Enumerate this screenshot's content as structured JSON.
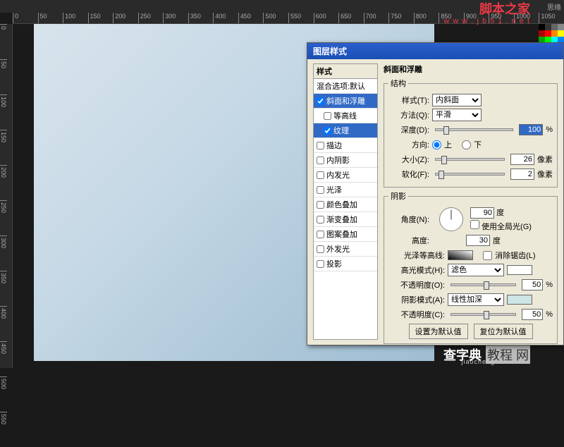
{
  "toolbar_text": "思缘",
  "watermark_top": {
    "main": "脚本之家",
    "sub": "w w w . j b 5 1 . n e t"
  },
  "watermark_bot": {
    "cn": "查字典",
    "box": "教程 网",
    "py": "jiaocheng"
  },
  "ruler_h": [
    "0",
    "50",
    "100",
    "150",
    "200",
    "250",
    "300",
    "350",
    "400",
    "450",
    "500",
    "550",
    "600",
    "650",
    "700",
    "750",
    "800",
    "850",
    "900",
    "950",
    "1000",
    "1050"
  ],
  "ruler_v": [
    "0",
    "50",
    "100",
    "150",
    "200",
    "250",
    "300",
    "350",
    "400",
    "450",
    "500",
    "550"
  ],
  "dialog": {
    "title": "图层样式",
    "styles_header": "样式",
    "blend_options": "混合选项:默认",
    "style_list": [
      {
        "label": "斜面和浮雕",
        "checked": true,
        "selected": true,
        "sub": false
      },
      {
        "label": "等高线",
        "checked": false,
        "selected": false,
        "sub": true
      },
      {
        "label": "纹理",
        "checked": true,
        "selected": true,
        "sub": true
      },
      {
        "label": "描边",
        "checked": false,
        "selected": false,
        "sub": false
      },
      {
        "label": "内阴影",
        "checked": false,
        "selected": false,
        "sub": false
      },
      {
        "label": "内发光",
        "checked": false,
        "selected": false,
        "sub": false
      },
      {
        "label": "光泽",
        "checked": false,
        "selected": false,
        "sub": false
      },
      {
        "label": "颜色叠加",
        "checked": false,
        "selected": false,
        "sub": false
      },
      {
        "label": "渐变叠加",
        "checked": false,
        "selected": false,
        "sub": false
      },
      {
        "label": "图案叠加",
        "checked": false,
        "selected": false,
        "sub": false
      },
      {
        "label": "外发光",
        "checked": false,
        "selected": false,
        "sub": false
      },
      {
        "label": "投影",
        "checked": false,
        "selected": false,
        "sub": false
      }
    ],
    "bevel_group": "斜面和浮雕",
    "structure_group": "结构",
    "style_label": "样式(T):",
    "style_val": "内斜面",
    "method_label": "方法(Q):",
    "method_val": "平滑",
    "depth_label": "深度(D):",
    "depth_val": "100",
    "percent": "%",
    "dir_label": "方向:",
    "dir_up": "上",
    "dir_down": "下",
    "size_label": "大小(Z):",
    "size_val": "26",
    "px": "像素",
    "soften_label": "软化(F):",
    "soften_val": "2",
    "shadow_group": "阴影",
    "angle_label": "角度(N):",
    "angle_val": "90",
    "deg": "度",
    "global_light": "使用全局光(G)",
    "altitude_label": "高度:",
    "altitude_val": "30",
    "gloss_label": "光泽等高线:",
    "antialias": "消除锯齿(L)",
    "highlight_mode_label": "高光模式(H):",
    "highlight_mode_val": "滤色",
    "highlight_opacity_label": "不透明度(O):",
    "highlight_opacity_val": "50",
    "shadow_mode_label": "阴影模式(A):",
    "shadow_mode_val": "线性加深",
    "shadow_opacity_label": "不透明度(C):",
    "shadow_opacity_val": "50",
    "highlight_color": "#ffffff",
    "shadow_color": "#cce5e5",
    "btn_default": "设置为默认值",
    "btn_reset": "复位为默认值"
  },
  "swatch_colors": [
    "#000",
    "#333",
    "#666",
    "#888",
    "#a00",
    "#f00",
    "#f80",
    "#ff0",
    "#0a0",
    "#0f0",
    "#0ff",
    "#08f",
    "#00f",
    "#80f",
    "#f0f",
    "#fff"
  ]
}
